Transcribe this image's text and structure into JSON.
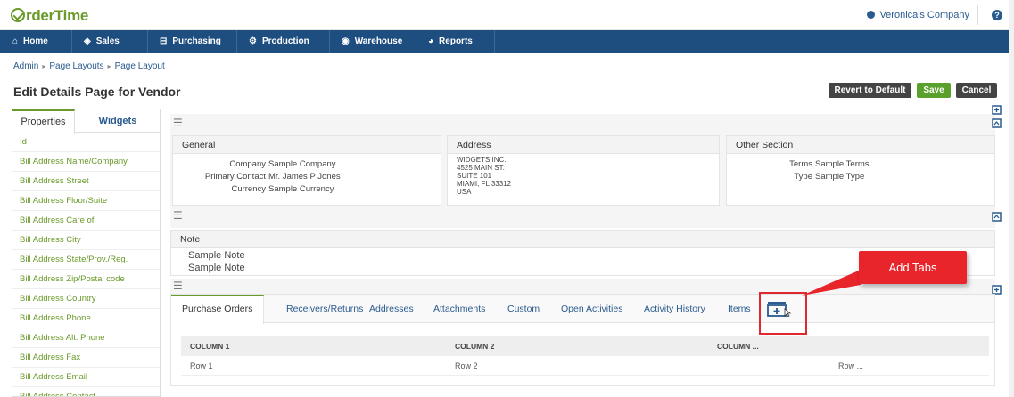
{
  "app": {
    "logo": "rderTime",
    "company": "Veronica's Company",
    "help": "?"
  },
  "nav": [
    {
      "label": "Home",
      "icon": "home-icon"
    },
    {
      "label": "Sales",
      "icon": "tag-icon"
    },
    {
      "label": "Purchasing",
      "icon": "cart-icon"
    },
    {
      "label": "Production",
      "icon": "cogs-icon"
    },
    {
      "label": "Warehouse",
      "icon": "globe-icon"
    },
    {
      "label": "Reports",
      "icon": "pie-chart-icon"
    }
  ],
  "breadcrumb": [
    "Admin",
    "Page Layouts",
    "Page Layout"
  ],
  "page_title": "Edit Details Page for Vendor",
  "buttons": {
    "revert": "Revert to Default",
    "save": "Save",
    "cancel": "Cancel"
  },
  "left_panel": {
    "tabs": [
      "Properties",
      "Widgets"
    ],
    "properties": [
      "Id",
      "Bill Address Name/Company",
      "Bill Address Street",
      "Bill Address Floor/Suite",
      "Bill Address Care of",
      "Bill Address City",
      "Bill Address State/Prov./Reg.",
      "Bill Address Zip/Postal code",
      "Bill Address Country",
      "Bill Address Phone",
      "Bill Address Alt. Phone",
      "Bill Address Fax",
      "Bill Address Email",
      "Bill Address Contact"
    ]
  },
  "sections": {
    "general": {
      "title": "General",
      "fields": [
        {
          "label": "Company",
          "value": "Sample Company"
        },
        {
          "label": "Primary Contact",
          "value": "Mr. James P Jones"
        },
        {
          "label": "Currency",
          "value": "Sample Currency"
        }
      ]
    },
    "address": {
      "title": "Address",
      "lines": [
        "WIDGETS INC.",
        "4525 MAIN ST.",
        "SUITE 101",
        "MIAMI, FL 33312",
        "USA"
      ]
    },
    "other": {
      "title": "Other Section",
      "fields": [
        {
          "label": "Terms",
          "value": "Sample Terms"
        },
        {
          "label": "Type",
          "value": "Sample Type"
        }
      ]
    },
    "note": {
      "title": "Note",
      "lines": [
        "Sample Note",
        "Sample Note"
      ]
    }
  },
  "tabs": [
    "Purchase Orders",
    "Receivers/Returns",
    "Addresses",
    "Attachments",
    "Custom",
    "Open Activities",
    "Activity History",
    "Items"
  ],
  "table": {
    "columns": [
      "COLUMN 1",
      "COLUMN 2",
      "COLUMN ..."
    ],
    "row": [
      "Row 1",
      "Row 2",
      "Row ..."
    ]
  },
  "callout": "Add Tabs",
  "colors": {
    "nav_bg": "#1e4d80",
    "accent_green": "#6a9a2a",
    "link_blue": "#2a5b8f",
    "callout_red": "#e8252b"
  }
}
